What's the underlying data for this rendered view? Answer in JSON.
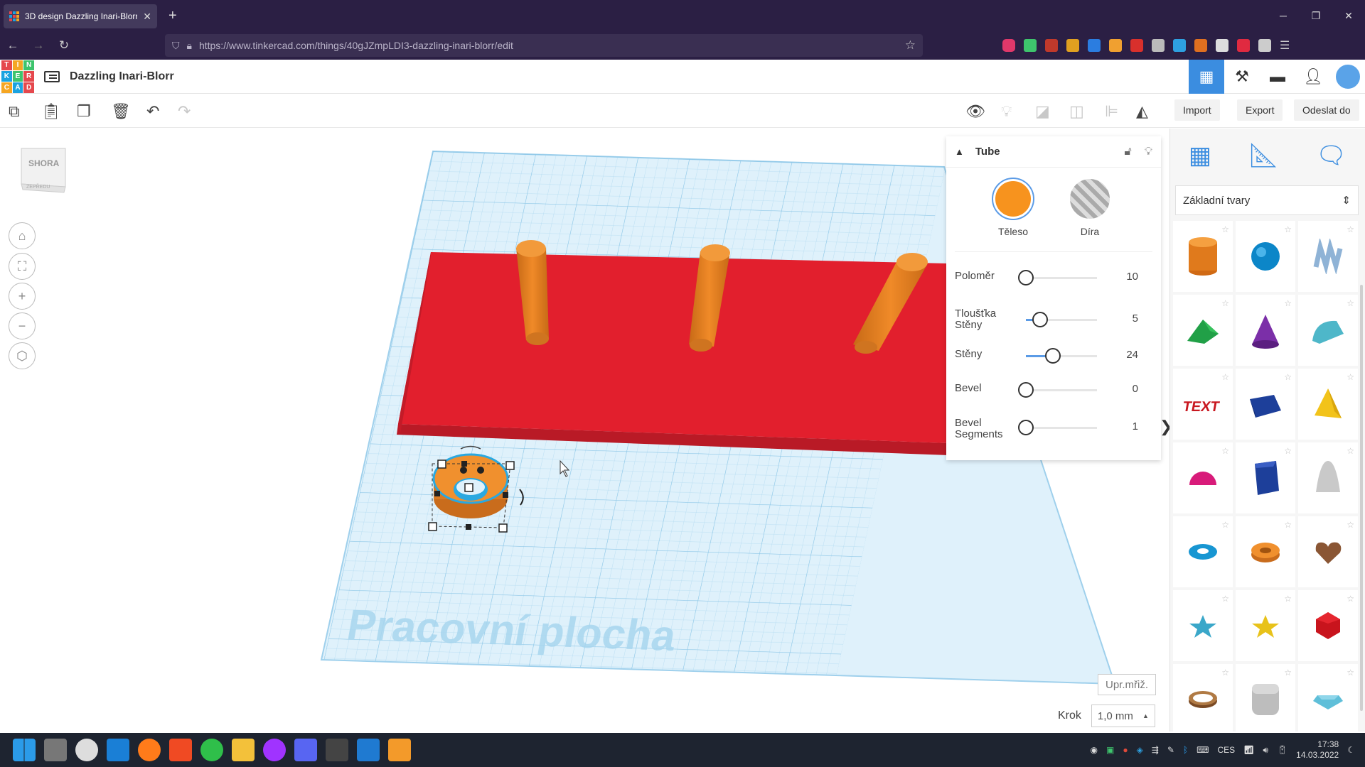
{
  "browser": {
    "tab_title": "3D design Dazzling Inari-Blorr | ",
    "url": "https://www.tinkercad.com/things/40gJZmpLDI3-dazzling-inari-blorr/edit"
  },
  "app": {
    "logo_letters": [
      "T",
      "I",
      "N",
      "K",
      "E",
      "R",
      "C",
      "A",
      "D"
    ],
    "design_title": "Dazzling Inari-Blorr",
    "accent_color": "#3b8de0"
  },
  "toolbar": {
    "import_label": "Import",
    "export_label": "Export",
    "send_label": "Odeslat do"
  },
  "viewcube": {
    "top_label": "SHORA",
    "front_label": "ZEPŘEDU"
  },
  "workplane": {
    "label": "Pracovní plocha",
    "edit_grid_label": "Upr.mřiž."
  },
  "snap": {
    "label": "Krok",
    "value": "1,0 mm"
  },
  "inspector": {
    "title": "Tube",
    "solid_label": "Těleso",
    "hole_label": "Díra",
    "solid_color": "#f7931e",
    "params": [
      {
        "label": "Poloměr",
        "value": "10",
        "fraction": 0.0
      },
      {
        "label": "Tloušťka Stěny",
        "value": "5",
        "fraction": 0.2
      },
      {
        "label": "Stěny",
        "value": "24",
        "fraction": 0.38
      },
      {
        "label": "Bevel",
        "value": "0",
        "fraction": 0.0
      },
      {
        "label": "Bevel Segments",
        "value": "1",
        "fraction": 0.0
      }
    ]
  },
  "library": {
    "selected": "Základní tvary",
    "shapes": [
      "box",
      "cylinder",
      "sphere",
      "scribble",
      "roof",
      "cone",
      "round-roof",
      "text",
      "wedge",
      "pyramid",
      "half-sphere",
      "polygon",
      "paraboloid",
      "torus",
      "tube",
      "heart",
      "star",
      "star-yellow",
      "icosahedron",
      "ring",
      "rounded-box",
      "gem"
    ]
  },
  "taskbar": {
    "lang": "CES",
    "time": "17:38",
    "date": "14.03.2022"
  }
}
